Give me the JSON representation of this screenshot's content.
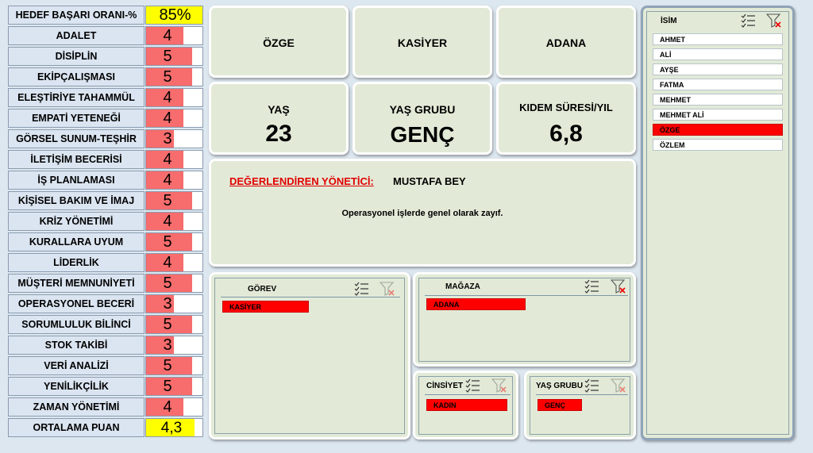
{
  "header": {
    "label": "HEDEF BAŞARI ORANI-%",
    "value": "85%"
  },
  "scores": [
    {
      "label": "ADALET",
      "value": 4
    },
    {
      "label": "DİSİPLİN",
      "value": 5
    },
    {
      "label": "EKİPÇALIŞMASI",
      "value": 5
    },
    {
      "label": "ELEŞTİRİYE TAHAMMÜL",
      "value": 4
    },
    {
      "label": "EMPATİ YETENEĞİ",
      "value": 4
    },
    {
      "label": "GÖRSEL SUNUM-TEŞHİR",
      "value": 3
    },
    {
      "label": "İLETİŞİM BECERİSİ",
      "value": 4
    },
    {
      "label": "İŞ PLANLAMASI",
      "value": 4
    },
    {
      "label": "KİŞİSEL BAKIM VE İMAJ",
      "value": 5
    },
    {
      "label": "KRİZ YÖNETİMİ",
      "value": 4
    },
    {
      "label": "KURALLARA UYUM",
      "value": 5
    },
    {
      "label": "LİDERLİK",
      "value": 4
    },
    {
      "label": "MÜŞTERİ MEMNUNİYETİ",
      "value": 5
    },
    {
      "label": "OPERASYONEL BECERİ",
      "value": 3
    },
    {
      "label": "SORUMLULUK BİLİNCİ",
      "value": 5
    },
    {
      "label": "STOK TAKİBİ",
      "value": 3
    },
    {
      "label": "VERİ ANALİZİ",
      "value": 5
    },
    {
      "label": "YENİLİKÇİLİK",
      "value": 5
    },
    {
      "label": "ZAMAN YÖNETİMİ",
      "value": 4
    }
  ],
  "score_max": 5,
  "average": {
    "label": "ORTALAMA PUAN",
    "value": "4,3",
    "numeric": 4.3
  },
  "info": {
    "name": "ÖZGE",
    "role": "KASİYER",
    "city": "ADANA",
    "age_label": "YAŞ",
    "age_value": "23",
    "age_group_label": "YAŞ GRUBU",
    "age_group_value": "GENÇ",
    "seniority_label": "KIDEM SÜRESİ/YIL",
    "seniority_value": "6,8"
  },
  "manager": {
    "label": "DEĞERLENDİREN YÖNETİCİ:",
    "name": "MUSTAFA BEY",
    "comment": "Operasyonel işlerde genel olarak zayıf."
  },
  "slicers": {
    "gorev": {
      "title": "GÖREV",
      "items": [
        {
          "label": "KASİYER",
          "selected": true
        }
      ]
    },
    "magaza": {
      "title": "MAĞAZA",
      "items": [
        {
          "label": "ADANA",
          "selected": true
        }
      ]
    },
    "cinsiyet": {
      "title": "CİNSİYET",
      "items": [
        {
          "label": "KADIN",
          "selected": true
        }
      ]
    },
    "yas_grubu": {
      "title": "YAŞ GRUBU",
      "items": [
        {
          "label": "GENÇ",
          "selected": true
        }
      ]
    },
    "isim": {
      "title": "İSİM",
      "items": [
        {
          "label": "AHMET",
          "selected": false
        },
        {
          "label": "ALİ",
          "selected": false
        },
        {
          "label": "AYŞE",
          "selected": false
        },
        {
          "label": "FATMA",
          "selected": false
        },
        {
          "label": "MEHMET",
          "selected": false
        },
        {
          "label": "MEHMET ALİ",
          "selected": false
        },
        {
          "label": "ÖZGE",
          "selected": true
        },
        {
          "label": "ÖZLEM",
          "selected": false
        }
      ]
    }
  },
  "icons": {
    "multi_select": "multi-select-icon",
    "clear_filter": "clear-filter-icon"
  },
  "colors": {
    "bar_red": "#f76c6c",
    "highlight_yellow": "#ffff00",
    "selected_red": "#ff0000",
    "panel_green": "#e2ead7",
    "manager_label_red": "#e00000"
  }
}
